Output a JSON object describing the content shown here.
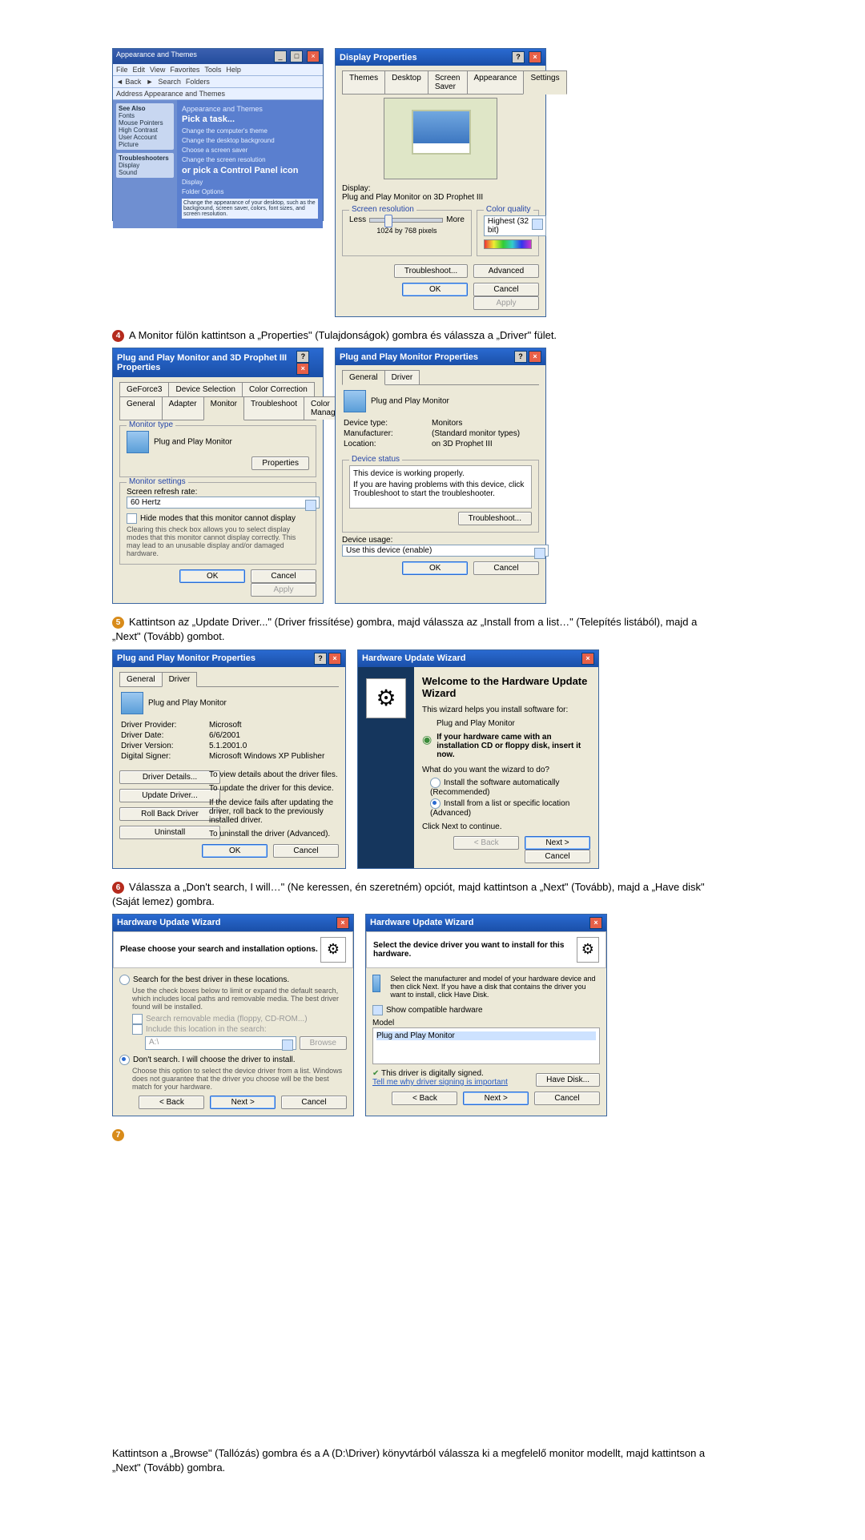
{
  "pair1": {
    "cp": {
      "title": "Appearance and Themes",
      "menu": [
        "File",
        "Edit",
        "View",
        "Favorites",
        "Tools",
        "Help"
      ],
      "toolbar_back": "Back",
      "toolbar_search": "Search",
      "toolbar_folders": "Folders",
      "address_label": "Address",
      "address_value": "Appearance and Themes",
      "side_seealso": "See Also",
      "side_items": [
        "Fonts",
        "Mouse Pointers",
        "High Contrast",
        "User Account Picture"
      ],
      "side_trouble": "Troubleshooters",
      "side_trouble_items": [
        "Display",
        "Sound"
      ],
      "subhead": "Appearance and Themes",
      "pick_task": "Pick a task...",
      "tasks": [
        "Change the computer's theme",
        "Change the desktop background",
        "Choose a screen saver",
        "Change the screen resolution"
      ],
      "or_cp": "or pick a Control Panel icon",
      "cp_icons": [
        "Display",
        "Folder Options"
      ],
      "cp_hint": "Change the appearance of your desktop, such as the background, screen saver, colors, font sizes, and screen resolution."
    },
    "dp": {
      "title": "Display Properties",
      "tabs": [
        "Themes",
        "Desktop",
        "Screen Saver",
        "Appearance",
        "Settings"
      ],
      "active_tab": "Settings",
      "display_label": "Display:",
      "display_value": "Plug and Play Monitor on 3D Prophet III",
      "res_group": "Screen resolution",
      "res_less": "Less",
      "res_more": "More",
      "res_value": "1024 by 768 pixels",
      "qual_group": "Color quality",
      "qual_value": "Highest (32 bit)",
      "btn_trouble": "Troubleshoot...",
      "btn_adv": "Advanced",
      "ok": "OK",
      "cancel": "Cancel",
      "apply": "Apply"
    }
  },
  "instr4": "A Monitor fülön kattintson a „Properties\" (Tulajdonságok) gombra és válassza a „Driver\" fület.",
  "pair2": {
    "left": {
      "title": "Plug and Play Monitor and 3D Prophet III Properties",
      "tabs_row1": [
        "GeForce3",
        "Device Selection",
        "Color Correction"
      ],
      "tabs_row2": [
        "General",
        "Adapter",
        "Monitor",
        "Troubleshoot",
        "Color Management"
      ],
      "active": "Monitor",
      "mt_group": "Monitor type",
      "mt_value": "Plug and Play Monitor",
      "btn_props": "Properties",
      "ms_group": "Monitor settings",
      "refresh_label": "Screen refresh rate:",
      "refresh_value": "60 Hertz",
      "hide_label": "Hide modes that this monitor cannot display",
      "hide_note": "Clearing this check box allows you to select display modes that this monitor cannot display correctly. This may lead to an unusable display and/or damaged hardware.",
      "ok": "OK",
      "cancel": "Cancel",
      "apply": "Apply"
    },
    "right": {
      "title": "Plug and Play Monitor Properties",
      "tabs": [
        "General",
        "Driver"
      ],
      "active": "General",
      "name": "Plug and Play Monitor",
      "devtype_l": "Device type:",
      "devtype_v": "Monitors",
      "manu_l": "Manufacturer:",
      "manu_v": "(Standard monitor types)",
      "loc_l": "Location:",
      "loc_v": "on 3D Prophet III",
      "ds_group": "Device status",
      "ds_text": "This device is working properly.",
      "ds_hint": "If you are having problems with this device, click Troubleshoot to start the troubleshooter.",
      "btn_trouble": "Troubleshoot...",
      "usage_l": "Device usage:",
      "usage_v": "Use this device (enable)",
      "ok": "OK",
      "cancel": "Cancel"
    }
  },
  "instr5": "Kattintson az „Update Driver...\" (Driver frissítése) gombra, majd válassza az „Install from a list…\" (Telepítés listából), majd a „Next\" (Tovább) gombot.",
  "pair3": {
    "left": {
      "title": "Plug and Play Monitor Properties",
      "tabs": [
        "General",
        "Driver"
      ],
      "active": "Driver",
      "name": "Plug and Play Monitor",
      "prov_l": "Driver Provider:",
      "prov_v": "Microsoft",
      "date_l": "Driver Date:",
      "date_v": "6/6/2001",
      "ver_l": "Driver Version:",
      "ver_v": "5.1.2001.0",
      "sig_l": "Digital Signer:",
      "sig_v": "Microsoft Windows XP Publisher",
      "btn_details": "Driver Details...",
      "desc_details": "To view details about the driver files.",
      "btn_update": "Update Driver...",
      "desc_update": "To update the driver for this device.",
      "btn_roll": "Roll Back Driver",
      "desc_roll": "If the device fails after updating the driver, roll back to the previously installed driver.",
      "btn_uninst": "Uninstall",
      "desc_uninst": "To uninstall the driver (Advanced).",
      "ok": "OK",
      "cancel": "Cancel"
    },
    "right": {
      "title": "Hardware Update Wizard",
      "welcome": "Welcome to the Hardware Update Wizard",
      "helps": "This wizard helps you install software for:",
      "dev": "Plug and Play Monitor",
      "cd_hint": "If your hardware came with an installation CD or floppy disk, insert it now.",
      "what": "What do you want the wizard to do?",
      "opt_auto": "Install the software automatically (Recommended)",
      "opt_list": "Install from a list or specific location (Advanced)",
      "click_next": "Click Next to continue.",
      "back": "< Back",
      "next": "Next >",
      "cancel": "Cancel"
    }
  },
  "instr6": "Válassza a „Don't search, I will…\" (Ne keressen, én szeretném) opciót, majd kattintson a „Next\" (Tovább), majd a „Have disk\" (Saját lemez) gombra.",
  "pair4": {
    "left": {
      "title": "Hardware Update Wizard",
      "head": "Please choose your search and installation options.",
      "opt_search": "Search for the best driver in these locations.",
      "search_note": "Use the check boxes below to limit or expand the default search, which includes local paths and removable media. The best driver found will be installed.",
      "chk_rem": "Search removable media (floppy, CD-ROM...)",
      "chk_inc": "Include this location in the search:",
      "path": "A:\\",
      "browse": "Browse",
      "opt_dont": "Don't search. I will choose the driver to install.",
      "dont_note": "Choose this option to select the device driver from a list. Windows does not guarantee that the driver you choose will be the best match for your hardware.",
      "back": "< Back",
      "next": "Next >",
      "cancel": "Cancel"
    },
    "right": {
      "title": "Hardware Update Wizard",
      "head": "Select the device driver you want to install for this hardware.",
      "hint": "Select the manufacturer and model of your hardware device and then click Next. If you have a disk that contains the driver you want to install, click Have Disk.",
      "chk_compat": "Show compatible hardware",
      "model_l": "Model",
      "model_v": "Plug and Play Monitor",
      "signed": "This driver is digitally signed.",
      "why": "Tell me why driver signing is important",
      "have_disk": "Have Disk...",
      "back": "< Back",
      "next": "Next >",
      "cancel": "Cancel"
    }
  },
  "instr_final": "Kattintson a „Browse\" (Tallózás) gombra és a A (D:\\Driver) könyvtárból válassza ki a megfelelő monitor modellt, majd kattintson a „Next\" (Tovább) gombra."
}
